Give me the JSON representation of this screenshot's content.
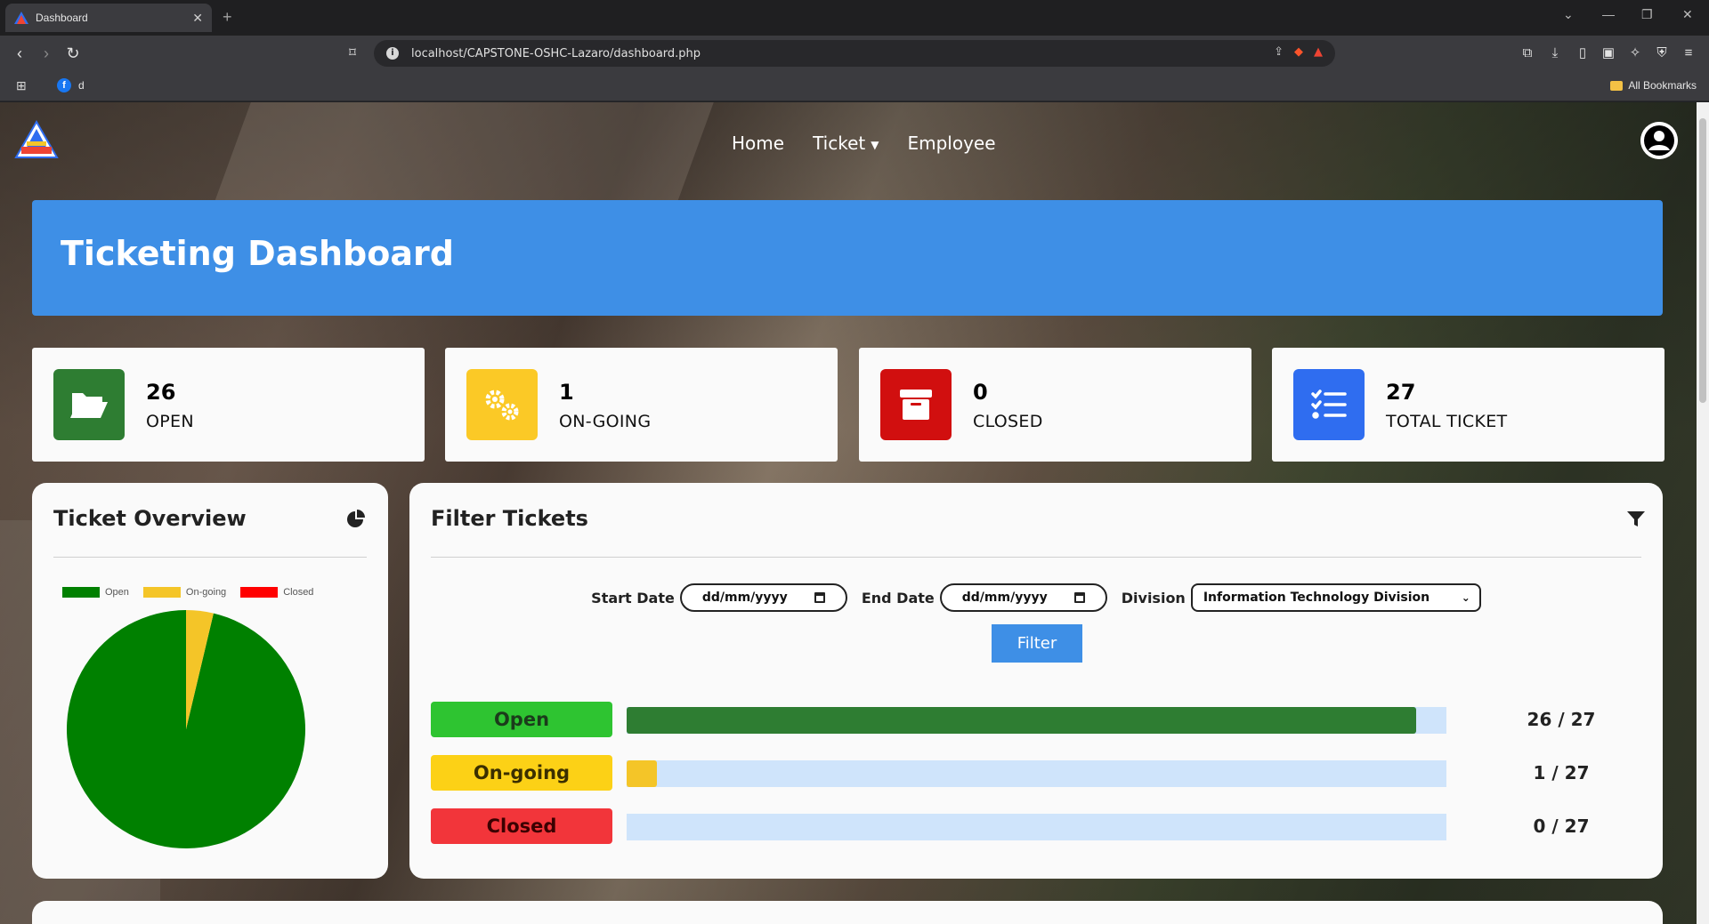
{
  "browser": {
    "tab_title": "Dashboard",
    "url": "localhost/CAPSTONE-OSHC-Lazaro/dashboard.php",
    "bookmark_item": "d",
    "all_bookmarks": "All Bookmarks"
  },
  "nav": {
    "home": "Home",
    "ticket": "Ticket",
    "employee": "Employee"
  },
  "banner": {
    "title": "Ticketing Dashboard"
  },
  "stats": [
    {
      "value": "26",
      "label": "OPEN",
      "color": "#2e7d32",
      "icon": "folder-open-icon"
    },
    {
      "value": "1",
      "label": "ON-GOING",
      "color": "#fbc926",
      "icon": "gears-icon"
    },
    {
      "value": "0",
      "label": "CLOSED",
      "color": "#d10f0f",
      "icon": "archive-box-icon"
    },
    {
      "value": "27",
      "label": "TOTAL TICKET",
      "color": "#2f6df0",
      "icon": "checklist-icon"
    }
  ],
  "overview": {
    "title": "Ticket Overview",
    "icon": "pie-chart-icon"
  },
  "chart_data": {
    "type": "pie",
    "categories": [
      "Open",
      "On-going",
      "Closed"
    ],
    "values": [
      26,
      1,
      0
    ],
    "colors": [
      "#008000",
      "#f4c528",
      "#ff0000"
    ],
    "legend": "top"
  },
  "filter": {
    "title": "Filter Tickets",
    "icon": "funnel-icon",
    "start_label": "Start Date",
    "start_value": "dd/mm/yyyy",
    "end_label": "End Date",
    "end_value": "dd/mm/yyyy",
    "division_label": "Division",
    "division_value": "Information Technology Division",
    "button": "Filter"
  },
  "progress": [
    {
      "label": "Open",
      "count": 26,
      "total": 27,
      "ratio": "26 / 27",
      "pill_color": "#2ec431",
      "fill_color": "#2e7d32",
      "text_color": "#1b3b1b"
    },
    {
      "label": "On-going",
      "count": 1,
      "total": 27,
      "ratio": "1 / 27",
      "pill_color": "#fcd116",
      "fill_color": "#f4c528",
      "text_color": "#3b2f00"
    },
    {
      "label": "Closed",
      "count": 0,
      "total": 27,
      "ratio": "0 / 27",
      "pill_color": "#f2353a",
      "fill_color": "#d10f0f",
      "text_color": "#3b0000"
    }
  ]
}
